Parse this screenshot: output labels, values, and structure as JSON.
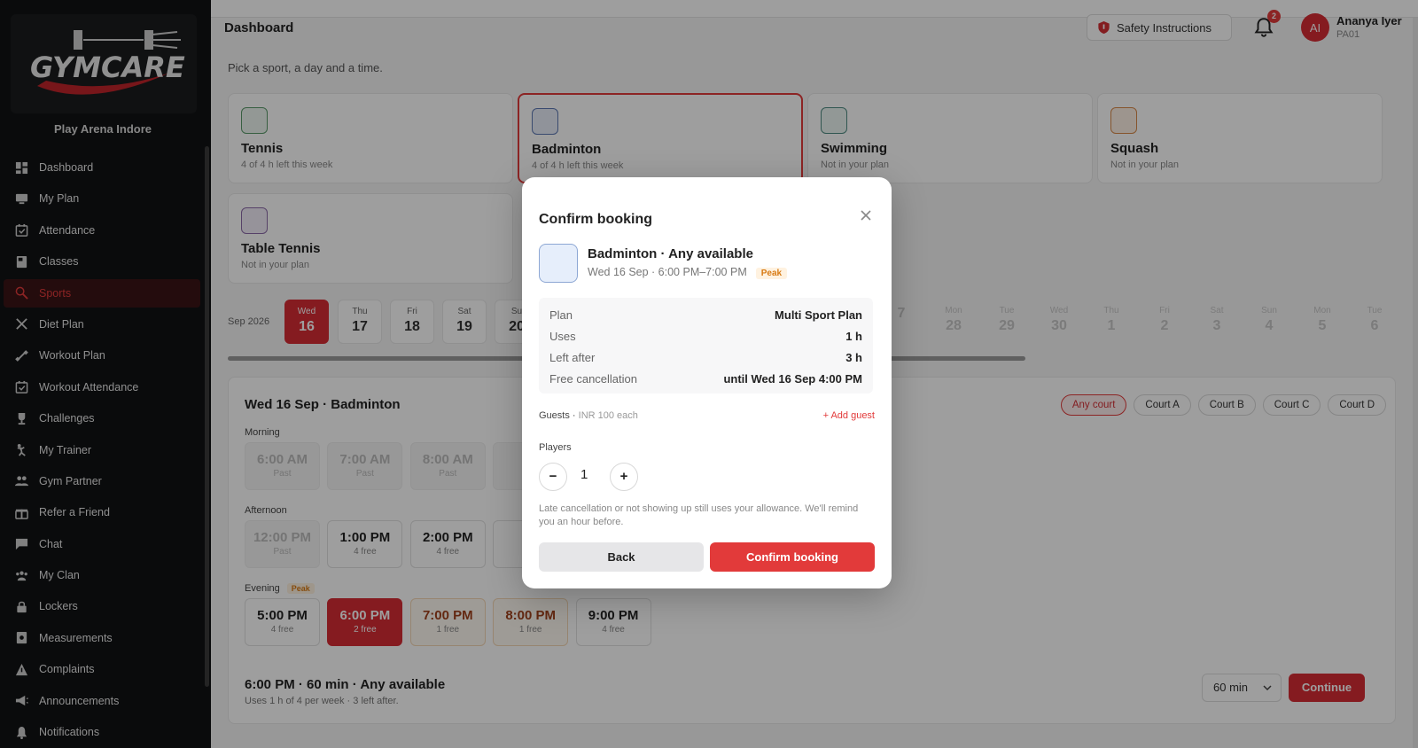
{
  "sidebar": {
    "logo_text": "GYMCARE",
    "arena_name": "Play Arena Indore",
    "items": [
      {
        "label": "Dashboard",
        "icon": "dashboard-icon",
        "active": false
      },
      {
        "label": "My Plan",
        "icon": "plan-icon",
        "active": false
      },
      {
        "label": "Attendance",
        "icon": "calendar-check-icon",
        "active": false
      },
      {
        "label": "Classes",
        "icon": "book-icon",
        "active": false
      },
      {
        "label": "Sports",
        "icon": "sports-icon",
        "active": true
      },
      {
        "label": "Diet Plan",
        "icon": "fork-knife-icon",
        "active": false
      },
      {
        "label": "Workout Plan",
        "icon": "dumbbell-icon",
        "active": false
      },
      {
        "label": "Workout Attendance",
        "icon": "calendar-check-icon",
        "active": false
      },
      {
        "label": "Challenges",
        "icon": "trophy-icon",
        "active": false
      },
      {
        "label": "My Trainer",
        "icon": "trainer-icon",
        "active": false
      },
      {
        "label": "Gym Partner",
        "icon": "people-icon",
        "active": false
      },
      {
        "label": "Refer a Friend",
        "icon": "gift-icon",
        "active": false
      },
      {
        "label": "Chat",
        "icon": "chat-icon",
        "active": false
      },
      {
        "label": "My Clan",
        "icon": "group-icon",
        "active": false
      },
      {
        "label": "Lockers",
        "icon": "lock-icon",
        "active": false
      },
      {
        "label": "Measurements",
        "icon": "ruler-icon",
        "active": false
      },
      {
        "label": "Complaints",
        "icon": "warning-icon",
        "active": false
      },
      {
        "label": "Announcements",
        "icon": "megaphone-icon",
        "active": false
      },
      {
        "label": "Notifications",
        "icon": "bell-icon",
        "active": false
      }
    ]
  },
  "header": {
    "title": "Dashboard",
    "safety_label": "Safety Instructions",
    "notification_count": "2",
    "user_initials": "AI",
    "user_name": "Ananya Iyer",
    "user_id": "PA01"
  },
  "page": {
    "subtitle": "Pick a sport, a day and a time."
  },
  "sports": [
    {
      "name": "Tennis",
      "sub": "4 of 4 h left this week",
      "color": "#5a9a6a",
      "bg": "#eef6f0",
      "selected": false
    },
    {
      "name": "Badminton",
      "sub": "4 of 4 h left this week",
      "color": "#5c78b3",
      "bg": "#e8eef9",
      "selected": true
    },
    {
      "name": "Swimming",
      "sub": "Not in your plan",
      "color": "#4e8b82",
      "bg": "#ecf5f3",
      "selected": false
    },
    {
      "name": "Squash",
      "sub": "Not in your plan",
      "color": "#d98a4a",
      "bg": "#fdf1e6",
      "selected": false
    },
    {
      "name": "Table Tennis",
      "sub": "Not in your plan",
      "color": "#8b6aa8",
      "bg": "#f3eef8",
      "selected": false
    }
  ],
  "calendar": {
    "month_label": "Sep 2026",
    "days": [
      {
        "dow": "Wed",
        "num": "16",
        "selected": true
      },
      {
        "dow": "Thu",
        "num": "17"
      },
      {
        "dow": "Fri",
        "num": "18"
      },
      {
        "dow": "Sat",
        "num": "19"
      },
      {
        "dow": "Su",
        "num": "20"
      },
      {
        "dow": "",
        "num": "7"
      },
      {
        "dow": "Mon",
        "num": "28"
      },
      {
        "dow": "Tue",
        "num": "29"
      },
      {
        "dow": "Wed",
        "num": "30"
      },
      {
        "dow": "Thu",
        "num": "1"
      },
      {
        "dow": "Fri",
        "num": "2"
      },
      {
        "dow": "Sat",
        "num": "3"
      },
      {
        "dow": "Sun",
        "num": "4"
      },
      {
        "dow": "Mon",
        "num": "5"
      },
      {
        "dow": "Tue",
        "num": "6"
      }
    ]
  },
  "slots": {
    "title": "Wed 16 Sep · Badminton",
    "courts": [
      "Any court",
      "Court A",
      "Court B",
      "Court C",
      "Court D"
    ],
    "morning_label": "Morning",
    "afternoon_label": "Afternoon",
    "evening_label": "Evening",
    "peak_label": "Peak",
    "morning": [
      {
        "time": "6:00 AM",
        "status": "Past",
        "kind": "past"
      },
      {
        "time": "7:00 AM",
        "status": "Past",
        "kind": "past"
      },
      {
        "time": "8:00 AM",
        "status": "Past",
        "kind": "past"
      },
      {
        "time": "9:",
        "status": "",
        "kind": "past"
      }
    ],
    "afternoon": [
      {
        "time": "12:00 PM",
        "status": "Past",
        "kind": "past"
      },
      {
        "time": "1:00 PM",
        "status": "4 free",
        "kind": "normal"
      },
      {
        "time": "2:00 PM",
        "status": "4 free",
        "kind": "normal"
      },
      {
        "time": "3:",
        "status": "",
        "kind": "normal"
      }
    ],
    "evening": [
      {
        "time": "5:00 PM",
        "status": "4 free",
        "kind": "normal"
      },
      {
        "time": "6:00 PM",
        "status": "2 free",
        "kind": "selected"
      },
      {
        "time": "7:00 PM",
        "status": "1 free",
        "kind": "peak"
      },
      {
        "time": "8:00 PM",
        "status": "1 free",
        "kind": "peak"
      },
      {
        "time": "9:00 PM",
        "status": "4 free",
        "kind": "normal"
      }
    ],
    "summary_title": "6:00 PM · 60 min · Any available",
    "summary_sub": "Uses 1 h of 4 per week · 3 left after.",
    "duration": "60 min",
    "continue_label": "Continue"
  },
  "modal": {
    "title": "Confirm booking",
    "sport_line": "Badminton · Any available",
    "time_line": "Wed 16 Sep · 6:00 PM–7:00 PM",
    "peak": "Peak",
    "details": [
      {
        "key": "Plan",
        "value": "Multi Sport Plan"
      },
      {
        "key": "Uses",
        "value": "1 h"
      },
      {
        "key": "Left after",
        "value": "3 h"
      },
      {
        "key": "Free cancellation",
        "value": "until Wed 16 Sep 4:00 PM"
      }
    ],
    "guests_label": "Guests",
    "guests_fee": "INR 100 each",
    "add_guest": "+ Add guest",
    "players_label": "Players",
    "players_value": "1",
    "minus": "−",
    "plus": "+",
    "note": "Late cancellation or not showing up still uses your allowance. We'll remind you an hour before.",
    "back_label": "Back",
    "confirm_label": "Confirm booking"
  },
  "colors": {
    "accent": "#e23a3a",
    "sidebar_bg": "#111214",
    "peak": "#d87b14"
  }
}
